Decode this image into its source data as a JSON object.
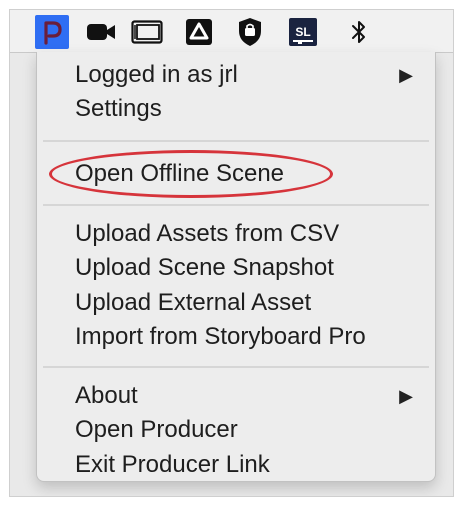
{
  "menubar": {
    "icons": [
      {
        "name": "producer-p-icon",
        "glyph": "P",
        "active": true,
        "color": "#2f6ef3"
      },
      {
        "name": "video-camera-icon"
      },
      {
        "name": "display-window-icon"
      },
      {
        "name": "triangle-app-icon"
      },
      {
        "name": "shield-lock-icon"
      },
      {
        "name": "sl-app-icon",
        "glyph": "SL"
      },
      {
        "name": "bluetooth-icon"
      }
    ]
  },
  "menu": {
    "section1": {
      "logged_in": "Logged in as jrl",
      "settings": "Settings"
    },
    "section2": {
      "open_offline_scene": "Open Offline Scene"
    },
    "section3": {
      "upload_csv": "Upload Assets from CSV",
      "upload_snapshot": "Upload Scene Snapshot",
      "upload_external": "Upload External Asset",
      "import_storyboard": "Import from Storyboard Pro"
    },
    "section4": {
      "about": "About",
      "open_producer": "Open Producer",
      "exit_link": "Exit Producer Link"
    },
    "submenu_arrow": "▶"
  },
  "annotation": {
    "highlight_color": "#d6343b"
  }
}
